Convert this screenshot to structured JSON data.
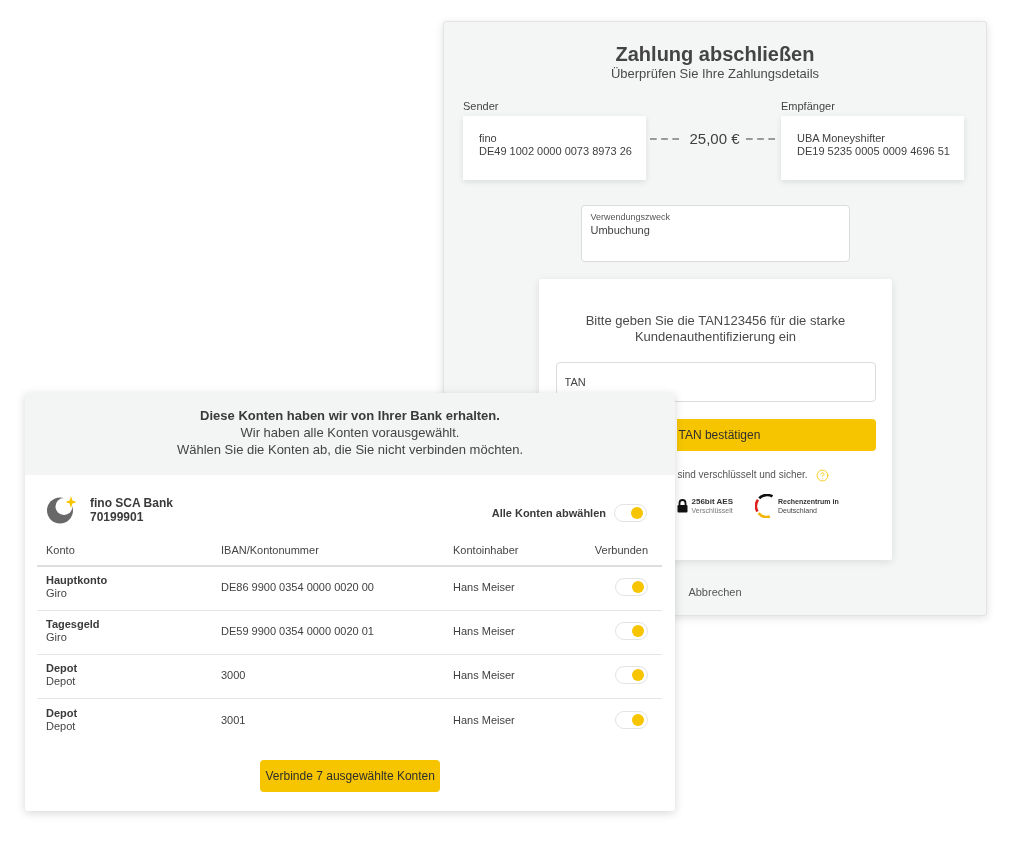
{
  "payment": {
    "title": "Zahlung abschließen",
    "subtitle": "Überprüfen Sie Ihre Zahlungsdetails",
    "sender": {
      "label": "Sender",
      "name": "fino",
      "iban": "DE49 1002 0000 0073 8973 26"
    },
    "amount": "25,00 €",
    "recipient": {
      "label": "Empfänger",
      "name": "UBA Moneyshifter",
      "iban": "DE19 5235 0005 0009 4696 51"
    },
    "purpose": {
      "label": "Verwendungszweck",
      "value": "Umbuchung"
    },
    "tan": {
      "instruction": "Bitte geben Sie die TAN123456 für die starke Kundenauthentifizierung ein",
      "placeholder": "TAN",
      "button": "TAN bestätigen",
      "security_note": "sind verschlüsselt und sicher.",
      "badges": [
        {
          "kind": "lock",
          "title": "256bit AES",
          "subtitle": "Verschlüsselt"
        },
        {
          "kind": "ring",
          "title": "Rechenzentrum in",
          "subtitle": "Deutschland"
        }
      ]
    },
    "cancel": "Abbrechen"
  },
  "accounts": {
    "heading": "Diese Konten haben wir von Ihrer Bank erhalten.",
    "lines": [
      "Wir haben alle Konten vorausgewählt.",
      "Wählen Sie die Konten ab, die Sie nicht verbinden möchten."
    ],
    "bank": {
      "name": "fino SCA Bank",
      "code": "70199901"
    },
    "deselect_all": {
      "label": "Alle Konten abwählen",
      "on": true
    },
    "table": {
      "columns": [
        "Konto",
        "IBAN/Kontonummer",
        "Kontoinhaber",
        "Verbunden"
      ],
      "rows": [
        {
          "name": "Hauptkonto",
          "type": "Giro",
          "iban": "DE86 9900 0354 0000 0020 00",
          "holder": "Hans Meiser",
          "on": true
        },
        {
          "name": "Tagesgeld",
          "type": "Giro",
          "iban": "DE59 9900 0354 0000 0020 01",
          "holder": "Hans Meiser",
          "on": true
        },
        {
          "name": "Depot",
          "type": "Depot",
          "iban": "3000",
          "holder": "Hans Meiser",
          "on": true
        },
        {
          "name": "Depot",
          "type": "Depot",
          "iban": "3001",
          "holder": "Hans Meiser",
          "on": true
        }
      ]
    },
    "button": "Verbinde 7 ausgewählte Konten"
  }
}
